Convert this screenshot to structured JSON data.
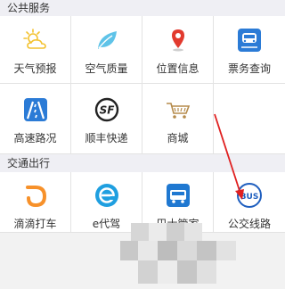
{
  "sections": {
    "public": {
      "title": "公共服务",
      "items": [
        {
          "label": "天气预报",
          "icon": "weather-icon"
        },
        {
          "label": "空气质量",
          "icon": "leaf-icon"
        },
        {
          "label": "位置信息",
          "icon": "location-pin-icon"
        },
        {
          "label": "票务查询",
          "icon": "train-ticket-icon"
        },
        {
          "label": "高速路况",
          "icon": "highway-icon"
        },
        {
          "label": "顺丰快递",
          "icon": "sf-express-icon"
        },
        {
          "label": "商城",
          "icon": "shopping-cart-icon"
        }
      ]
    },
    "transport": {
      "title": "交通出行",
      "items": [
        {
          "label": "滴滴打车",
          "icon": "didi-icon"
        },
        {
          "label": "e代驾",
          "icon": "e-driver-icon"
        },
        {
          "label": "巴士管家",
          "icon": "bus-manager-icon"
        },
        {
          "label": "公交线路",
          "icon": "bus-icon"
        }
      ]
    }
  },
  "colors": {
    "accent_blue": "#2b7bd6",
    "didi_orange": "#f7912a",
    "arrow_red": "#e02020",
    "header_bg": "#efeff4"
  }
}
